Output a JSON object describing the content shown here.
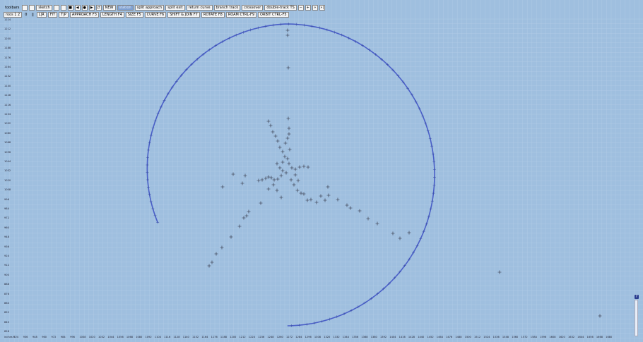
{
  "toolbar": {
    "row1": [
      {
        "id": "toolbars",
        "label": "toolbars",
        "kind": "plain"
      },
      {
        "id": "color-swatch",
        "label": "",
        "kind": "icon"
      },
      {
        "id": "undo",
        "label": "",
        "kind": "icon"
      },
      {
        "id": "sketch",
        "label": "sketch",
        "kind": "btn"
      },
      {
        "id": "pointer",
        "label": "",
        "kind": "icon"
      },
      {
        "id": "zoom",
        "label": "",
        "kind": "icon"
      },
      {
        "id": "square",
        "label": "■",
        "kind": "icon"
      },
      {
        "id": "arrow-left",
        "label": "◀",
        "kind": "icon"
      },
      {
        "id": "arrow-dot",
        "label": "●",
        "kind": "icon"
      },
      {
        "id": "arrow-right",
        "label": "▶",
        "kind": "icon"
      },
      {
        "id": "swap",
        "label": "⇄",
        "kind": "icon"
      },
      {
        "id": "new",
        "label": "NEW",
        "kind": "btn"
      },
      {
        "id": "station",
        "label": "station",
        "kind": "active"
      },
      {
        "id": "split-approach",
        "label": "split approach",
        "kind": "btn"
      },
      {
        "id": "split-exit",
        "label": "split exit",
        "kind": "btn"
      },
      {
        "id": "return-curve",
        "label": "return curve",
        "kind": "btn"
      },
      {
        "id": "branch-track",
        "label": "branch track",
        "kind": "btn"
      },
      {
        "id": "crossover",
        "label": "crossover",
        "kind": "btn"
      },
      {
        "id": "double-track",
        "label": "double-track TS",
        "kind": "btn"
      },
      {
        "id": "minus",
        "label": "−",
        "kind": "icon"
      },
      {
        "id": "plus",
        "label": "+",
        "kind": "icon"
      },
      {
        "id": "fast-fwd",
        "label": "»",
        "kind": "icon"
      },
      {
        "id": "end",
        "label": "»|",
        "kind": "icon"
      }
    ],
    "row2": [
      {
        "id": "roos",
        "label": "roos 1 2",
        "kind": "btn"
      },
      {
        "id": "zero",
        "label": "0",
        "kind": "plain"
      },
      {
        "id": "pipe",
        "label": "||",
        "kind": "plain"
      },
      {
        "id": "lr",
        "label": "L|R",
        "kind": "btn"
      },
      {
        "id": "fit",
        "label": "FIT",
        "kind": "btn"
      },
      {
        "id": "tp",
        "label": "T|P",
        "kind": "btn"
      },
      {
        "id": "approach",
        "label": "APPROACH F3",
        "kind": "btn"
      },
      {
        "id": "length",
        "label": "LENGTH F4",
        "kind": "btn"
      },
      {
        "id": "size",
        "label": "SIZE F5",
        "kind": "btn"
      },
      {
        "id": "curve",
        "label": "CURVE F6",
        "kind": "btn"
      },
      {
        "id": "shift-join",
        "label": "SHIFT & JOIN F7",
        "kind": "btn"
      },
      {
        "id": "rotate",
        "label": "ROTATE F8",
        "kind": "btn"
      },
      {
        "id": "roam",
        "label": "ROAM CTRL-F9",
        "kind": "btn"
      },
      {
        "id": "orbit",
        "label": "ORBIT CTRL-F5",
        "kind": "btn"
      }
    ]
  },
  "axes": {
    "y_labels": [
      "1224",
      "1212",
      "1200",
      "1188",
      "1176",
      "1164",
      "1152",
      "1140",
      "1128",
      "1116",
      "1104",
      "1092",
      "1080",
      "1068",
      "1056",
      "1044",
      "1032",
      "1020",
      "1008",
      "996",
      "984",
      "972",
      "960",
      "948",
      "936",
      "924",
      "912",
      "900",
      "888",
      "876",
      "864",
      "852",
      "840",
      "828"
    ],
    "x_labels": [
      "inches 0",
      "924",
      "936",
      "948",
      "960",
      "972",
      "984",
      "996",
      "1008",
      "1020",
      "1032",
      "1044",
      "1056",
      "1068",
      "1080",
      "1092",
      "1104",
      "1116",
      "1128",
      "1140",
      "1152",
      "1164",
      "1176",
      "1188",
      "1200",
      "1212",
      "1224",
      "1236",
      "1248",
      "1260",
      "1272",
      "1284",
      "1296",
      "1308",
      "1320",
      "1332",
      "1344",
      "1356",
      "1368",
      "1380",
      "1392",
      "1404",
      "1416",
      "1428",
      "1440",
      "1452",
      "1464",
      "1476",
      "1488",
      "1500",
      "1512",
      "1524",
      "1536",
      "1548",
      "1560",
      "1572",
      "1584",
      "1596",
      "1608",
      "1620",
      "1632",
      "1644",
      "1656",
      "1668",
      "1680"
    ]
  },
  "help_label": "?",
  "colors": {
    "background": "#9fbfdf",
    "grid": "#b4cde6",
    "track": "#4a5fc8",
    "marker": "#2a2a3a",
    "active_button": "#7e9fd0"
  }
}
